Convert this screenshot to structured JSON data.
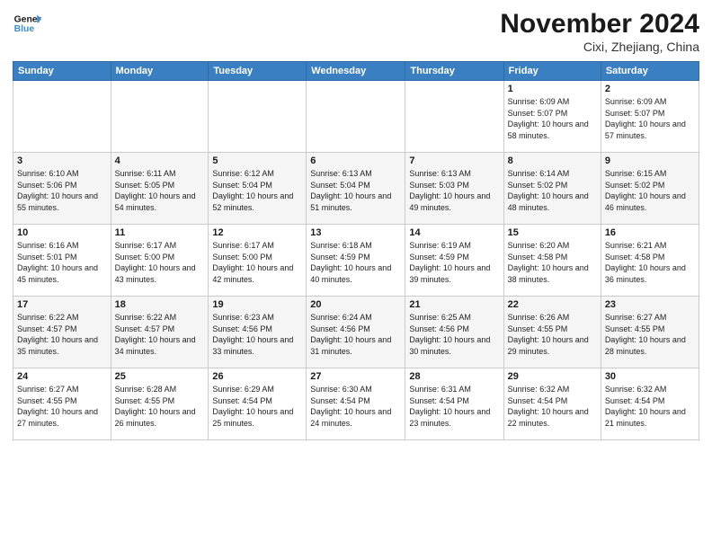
{
  "header": {
    "logo_line1": "General",
    "logo_line2": "Blue",
    "month_title": "November 2024",
    "location": "Cixi, Zhejiang, China"
  },
  "calendar": {
    "days_of_week": [
      "Sunday",
      "Monday",
      "Tuesday",
      "Wednesday",
      "Thursday",
      "Friday",
      "Saturday"
    ],
    "weeks": [
      [
        {
          "day": "",
          "info": ""
        },
        {
          "day": "",
          "info": ""
        },
        {
          "day": "",
          "info": ""
        },
        {
          "day": "",
          "info": ""
        },
        {
          "day": "",
          "info": ""
        },
        {
          "day": "1",
          "info": "Sunrise: 6:09 AM\nSunset: 5:07 PM\nDaylight: 10 hours and 58 minutes."
        },
        {
          "day": "2",
          "info": "Sunrise: 6:09 AM\nSunset: 5:07 PM\nDaylight: 10 hours and 57 minutes."
        }
      ],
      [
        {
          "day": "3",
          "info": "Sunrise: 6:10 AM\nSunset: 5:06 PM\nDaylight: 10 hours and 55 minutes."
        },
        {
          "day": "4",
          "info": "Sunrise: 6:11 AM\nSunset: 5:05 PM\nDaylight: 10 hours and 54 minutes."
        },
        {
          "day": "5",
          "info": "Sunrise: 6:12 AM\nSunset: 5:04 PM\nDaylight: 10 hours and 52 minutes."
        },
        {
          "day": "6",
          "info": "Sunrise: 6:13 AM\nSunset: 5:04 PM\nDaylight: 10 hours and 51 minutes."
        },
        {
          "day": "7",
          "info": "Sunrise: 6:13 AM\nSunset: 5:03 PM\nDaylight: 10 hours and 49 minutes."
        },
        {
          "day": "8",
          "info": "Sunrise: 6:14 AM\nSunset: 5:02 PM\nDaylight: 10 hours and 48 minutes."
        },
        {
          "day": "9",
          "info": "Sunrise: 6:15 AM\nSunset: 5:02 PM\nDaylight: 10 hours and 46 minutes."
        }
      ],
      [
        {
          "day": "10",
          "info": "Sunrise: 6:16 AM\nSunset: 5:01 PM\nDaylight: 10 hours and 45 minutes."
        },
        {
          "day": "11",
          "info": "Sunrise: 6:17 AM\nSunset: 5:00 PM\nDaylight: 10 hours and 43 minutes."
        },
        {
          "day": "12",
          "info": "Sunrise: 6:17 AM\nSunset: 5:00 PM\nDaylight: 10 hours and 42 minutes."
        },
        {
          "day": "13",
          "info": "Sunrise: 6:18 AM\nSunset: 4:59 PM\nDaylight: 10 hours and 40 minutes."
        },
        {
          "day": "14",
          "info": "Sunrise: 6:19 AM\nSunset: 4:59 PM\nDaylight: 10 hours and 39 minutes."
        },
        {
          "day": "15",
          "info": "Sunrise: 6:20 AM\nSunset: 4:58 PM\nDaylight: 10 hours and 38 minutes."
        },
        {
          "day": "16",
          "info": "Sunrise: 6:21 AM\nSunset: 4:58 PM\nDaylight: 10 hours and 36 minutes."
        }
      ],
      [
        {
          "day": "17",
          "info": "Sunrise: 6:22 AM\nSunset: 4:57 PM\nDaylight: 10 hours and 35 minutes."
        },
        {
          "day": "18",
          "info": "Sunrise: 6:22 AM\nSunset: 4:57 PM\nDaylight: 10 hours and 34 minutes."
        },
        {
          "day": "19",
          "info": "Sunrise: 6:23 AM\nSunset: 4:56 PM\nDaylight: 10 hours and 33 minutes."
        },
        {
          "day": "20",
          "info": "Sunrise: 6:24 AM\nSunset: 4:56 PM\nDaylight: 10 hours and 31 minutes."
        },
        {
          "day": "21",
          "info": "Sunrise: 6:25 AM\nSunset: 4:56 PM\nDaylight: 10 hours and 30 minutes."
        },
        {
          "day": "22",
          "info": "Sunrise: 6:26 AM\nSunset: 4:55 PM\nDaylight: 10 hours and 29 minutes."
        },
        {
          "day": "23",
          "info": "Sunrise: 6:27 AM\nSunset: 4:55 PM\nDaylight: 10 hours and 28 minutes."
        }
      ],
      [
        {
          "day": "24",
          "info": "Sunrise: 6:27 AM\nSunset: 4:55 PM\nDaylight: 10 hours and 27 minutes."
        },
        {
          "day": "25",
          "info": "Sunrise: 6:28 AM\nSunset: 4:55 PM\nDaylight: 10 hours and 26 minutes."
        },
        {
          "day": "26",
          "info": "Sunrise: 6:29 AM\nSunset: 4:54 PM\nDaylight: 10 hours and 25 minutes."
        },
        {
          "day": "27",
          "info": "Sunrise: 6:30 AM\nSunset: 4:54 PM\nDaylight: 10 hours and 24 minutes."
        },
        {
          "day": "28",
          "info": "Sunrise: 6:31 AM\nSunset: 4:54 PM\nDaylight: 10 hours and 23 minutes."
        },
        {
          "day": "29",
          "info": "Sunrise: 6:32 AM\nSunset: 4:54 PM\nDaylight: 10 hours and 22 minutes."
        },
        {
          "day": "30",
          "info": "Sunrise: 6:32 AM\nSunset: 4:54 PM\nDaylight: 10 hours and 21 minutes."
        }
      ]
    ]
  }
}
